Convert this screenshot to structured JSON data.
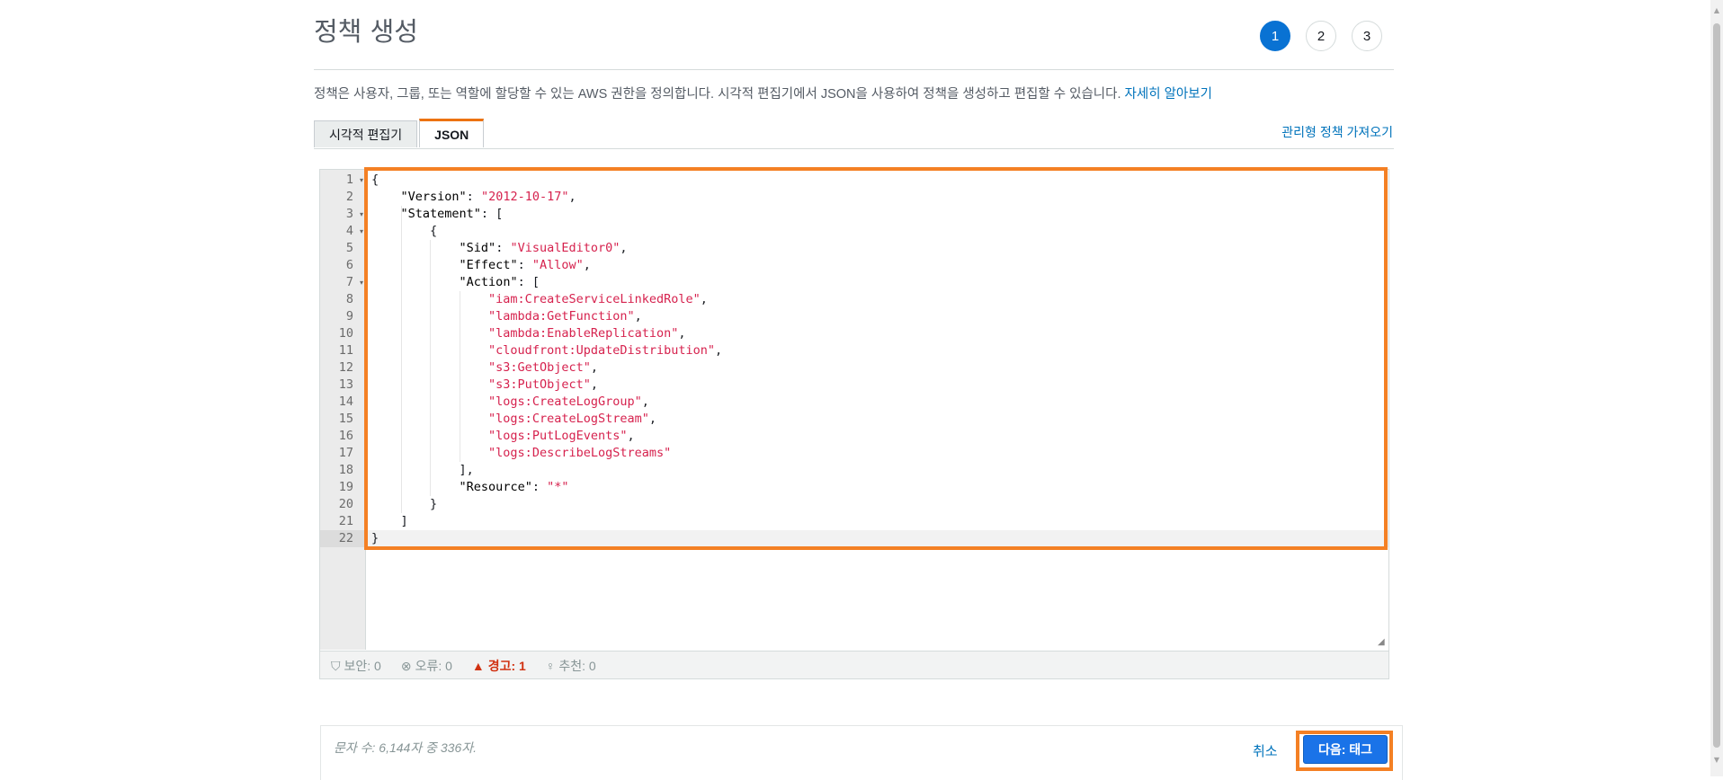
{
  "header": {
    "title": "정책 생성",
    "steps": [
      "1",
      "2",
      "3"
    ]
  },
  "description": {
    "text": "정책은 사용자, 그룹, 또는 역할에 할당할 수 있는 AWS 권한을 정의합니다. 시각적 편집기에서 JSON을 사용하여 정책을 생성하고 편집할 수 있습니다. ",
    "link": "자세히 알아보기"
  },
  "tabs": [
    {
      "label": "시각적 편집기"
    },
    {
      "label": "JSON"
    }
  ],
  "import_link": "관리형 정책 가져오기",
  "editor": {
    "line_numbers": [
      "1",
      "2",
      "3",
      "4",
      "5",
      "6",
      "7",
      "8",
      "9",
      "10",
      "11",
      "12",
      "13",
      "14",
      "15",
      "16",
      "17",
      "18",
      "19",
      "20",
      "21",
      "22"
    ],
    "lines": [
      "{",
      "    \"Version\": \"2012-10-17\",",
      "    \"Statement\": [",
      "        {",
      "            \"Sid\": \"VisualEditor0\",",
      "            \"Effect\": \"Allow\",",
      "            \"Action\": [",
      "                \"iam:CreateServiceLinkedRole\",",
      "                \"lambda:GetFunction\",",
      "                \"lambda:EnableReplication\",",
      "                \"cloudfront:UpdateDistribution\",",
      "                \"s3:GetObject\",",
      "                \"s3:PutObject\",",
      "                \"logs:CreateLogGroup\",",
      "                \"logs:CreateLogStream\",",
      "                \"logs:PutLogEvents\",",
      "                \"logs:DescribeLogStreams\"",
      "            ],",
      "            \"Resource\": \"*\"",
      "        }",
      "    ]",
      "}"
    ]
  },
  "status": {
    "security": "보안: 0",
    "errors": "오류: 0",
    "warnings": "경고: 1",
    "suggestions": "추천: 0"
  },
  "footer": {
    "char_count": "문자 수: 6,144자 중 336자.",
    "cancel": "취소",
    "next": "다음: 태그"
  }
}
